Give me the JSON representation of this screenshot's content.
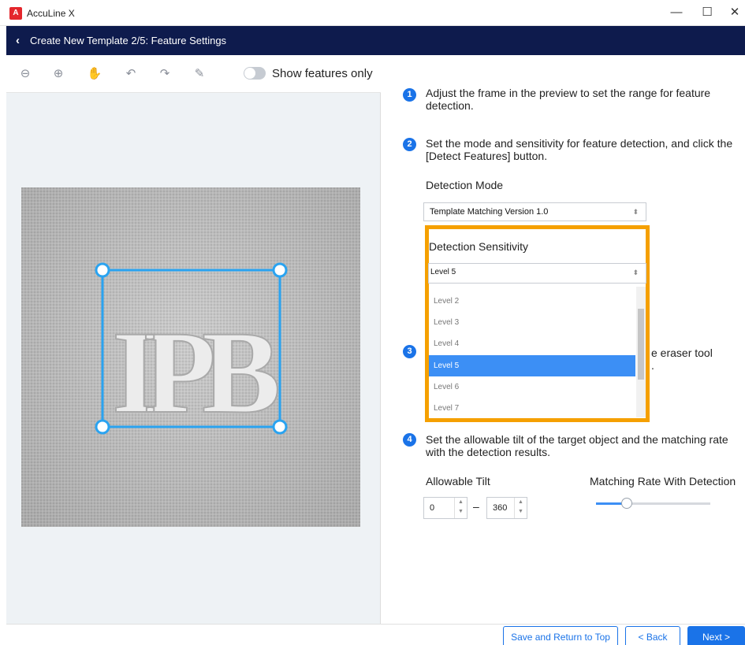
{
  "window": {
    "logo_text": "A",
    "app_title": "AccuLine X",
    "minimize": "—",
    "maximize": "☐",
    "close": "✕"
  },
  "header": {
    "back_icon": "‹",
    "title": "Create New Template 2/5: Feature Settings"
  },
  "toolbar": {
    "tools": [
      {
        "name": "zoom-out-icon",
        "glyph": "⊖"
      },
      {
        "name": "zoom-in-icon",
        "glyph": "⊕"
      },
      {
        "name": "hand-pan-icon",
        "glyph": "✋"
      },
      {
        "name": "undo-icon",
        "glyph": "↶"
      },
      {
        "name": "redo-icon",
        "glyph": "↷"
      },
      {
        "name": "eraser-icon",
        "glyph": "✎"
      }
    ],
    "toggle_label": "Show features only",
    "toggle_on": false
  },
  "preview": {
    "embroidery_text": "IPB"
  },
  "steps": {
    "step1": {
      "num": "1",
      "text": "Adjust the frame in the preview to set the range for feature detection."
    },
    "step2": {
      "num": "2",
      "text": "Set the mode and sensitivity for feature detection, and click the [Detect Features] button."
    },
    "detection_mode_label": "Detection Mode",
    "detection_mode_value": "Template Matching Version 1.0",
    "detection_sensitivity_label": "Detection Sensitivity",
    "detection_sensitivity_value": "Level 5",
    "sensitivity_options": [
      "Level 2",
      "Level 3",
      "Level 4",
      "Level 5",
      "Level 6",
      "Level 7"
    ],
    "sensitivity_selected": "Level 5",
    "step3": {
      "num": "3",
      "text_right": "e eraser tool",
      "text_right2": "."
    },
    "step4": {
      "num": "4",
      "text": "Set the allowable tilt of the target object and the matching rate with the detection results."
    },
    "allowable_tilt_label": "Allowable Tilt",
    "tilt_min": "0",
    "tilt_dash": "–",
    "tilt_max": "360",
    "matching_rate_label": "Matching Rate With Detection",
    "matching_rate_level": 0.27
  },
  "footer": {
    "save_return": "Save and Return to Top",
    "back": "< Back",
    "next": "Next >"
  },
  "colors": {
    "header_bg": "#0e1b4d",
    "accent_blue": "#1a73e8",
    "highlight_orange": "#f5a000",
    "frame_blue": "#2aa3f0"
  }
}
